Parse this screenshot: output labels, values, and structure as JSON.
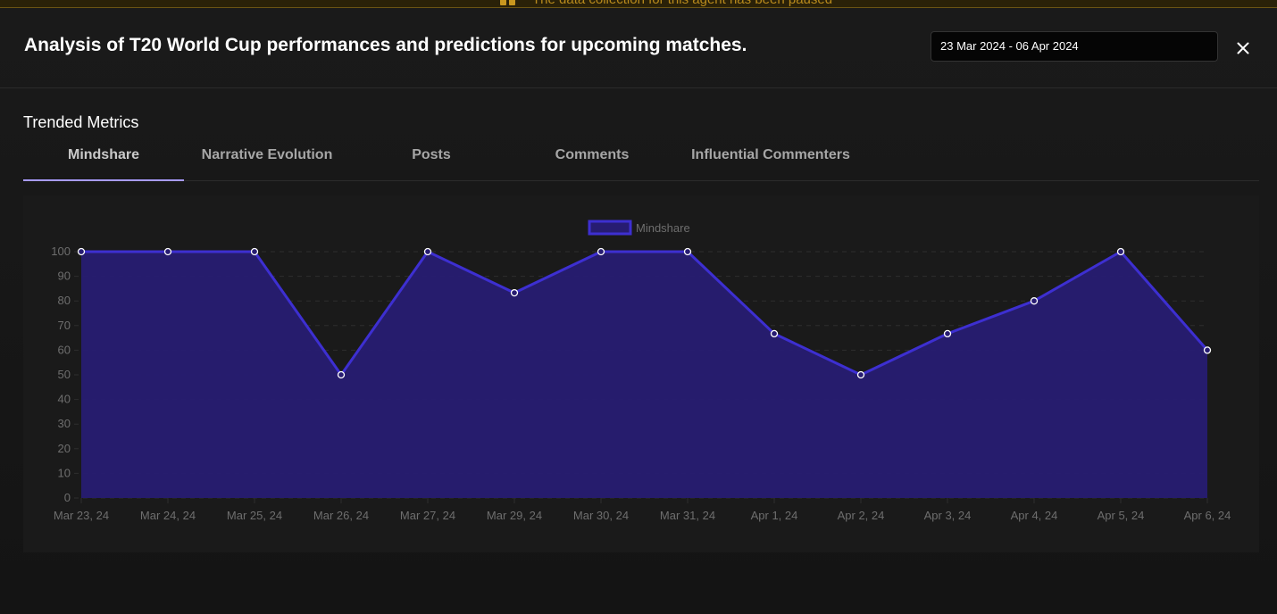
{
  "banner": {
    "text": "The data collection for this agent has been paused",
    "icon": "pause-icon",
    "color": "#c9971f"
  },
  "header": {
    "title": "Analysis of T20 World Cup performances and predictions for upcoming matches.",
    "date_range": "23 Mar 2024 - 06 Apr 2024",
    "close_icon": "close-icon"
  },
  "section": {
    "title": "Trended Metrics"
  },
  "tabs": [
    {
      "label": "Mindshare",
      "active": true
    },
    {
      "label": "Narrative Evolution",
      "active": false
    },
    {
      "label": "Posts",
      "active": false
    },
    {
      "label": "Comments",
      "active": false
    },
    {
      "label": "Influential Commenters",
      "active": false
    }
  ],
  "colors": {
    "accent": "#a89bff",
    "series_line": "#3d2fd1",
    "series_fill": "#271c72",
    "background": "#121212"
  },
  "chart_data": {
    "type": "area",
    "categories": [
      "Mar 23, 24",
      "Mar 24, 24",
      "Mar 25, 24",
      "Mar 26, 24",
      "Mar 27, 24",
      "Mar 29, 24",
      "Mar 30, 24",
      "Mar 31, 24",
      "Apr 1, 24",
      "Apr 2, 24",
      "Apr 3, 24",
      "Apr 4, 24",
      "Apr 5, 24",
      "Apr 6, 24"
    ],
    "series": [
      {
        "name": "Mindshare",
        "values": [
          100,
          100,
          100,
          50,
          100,
          83.3,
          100,
          100,
          66.7,
          50,
          66.7,
          80,
          100,
          60
        ]
      }
    ],
    "ylim": [
      0,
      100
    ],
    "yticks": [
      0,
      10,
      20,
      30,
      40,
      50,
      60,
      70,
      80,
      90,
      100
    ],
    "grid": true,
    "legend": "top-center"
  }
}
